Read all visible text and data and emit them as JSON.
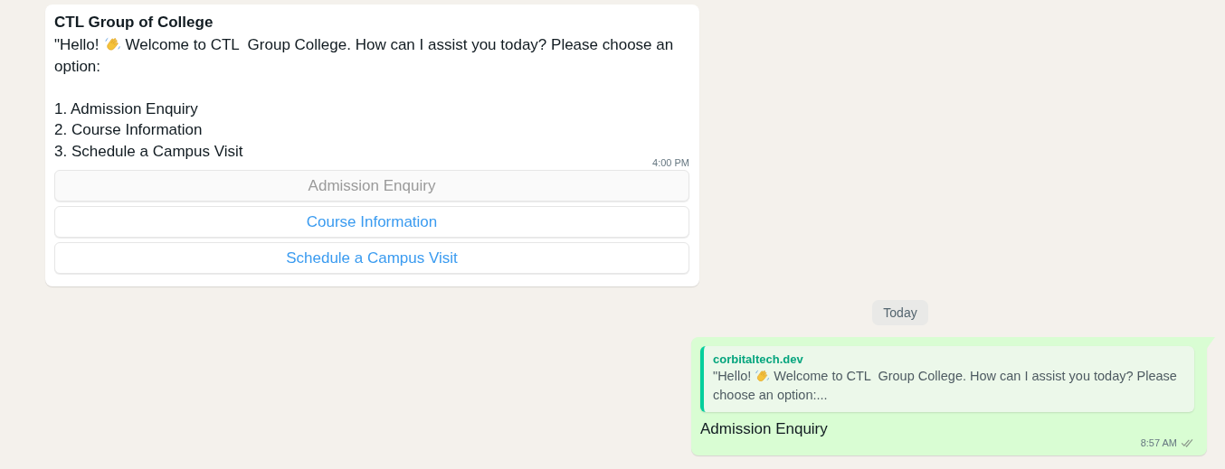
{
  "incoming": {
    "sender": "CTL Group of College",
    "greeting": "\"Hello!",
    "intro": [
      "Welcome to CTL  Group College. How can I assist you today? Please choose an",
      "option:"
    ],
    "options": [
      "1. Admission Enquiry",
      "2. Course Information",
      "3. Schedule a Campus Visit"
    ],
    "time": "4:00 PM",
    "buttons": [
      {
        "label": "Admission Enquiry",
        "disabled": true
      },
      {
        "label": "Course Information",
        "disabled": false
      },
      {
        "label": "Schedule a Campus Visit",
        "disabled": false
      }
    ]
  },
  "date_chip": "Today",
  "outgoing": {
    "quote": {
      "author": "corbitaltech.dev",
      "greeting": "\"Hello!",
      "text": [
        "Welcome to CTL  Group College. How can I assist you today? Please",
        "choose an option:..."
      ]
    },
    "text": "Admission Enquiry",
    "time": "8:57 AM",
    "read": true
  }
}
